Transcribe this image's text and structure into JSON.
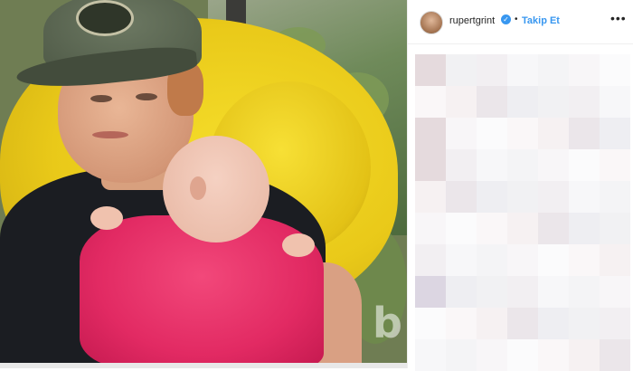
{
  "post": {
    "username": "rupertgrint",
    "verified_mark": "✓",
    "separator": "•",
    "follow_label": "Takip Et",
    "more_label": "•••",
    "watermark": "b"
  },
  "icons": {
    "verified": "verified-badge-icon",
    "more": "more-options-icon"
  },
  "colors": {
    "link": "#3897f0",
    "text": "#262626"
  }
}
